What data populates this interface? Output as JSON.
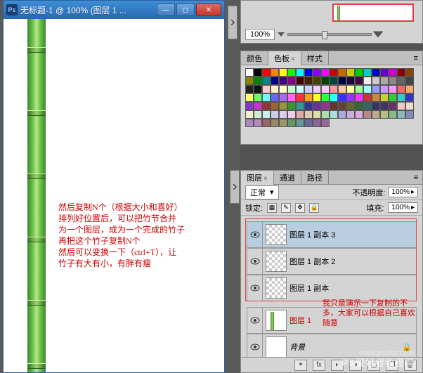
{
  "doc": {
    "title": "无标题-1 @ 100% (图层 1 ..."
  },
  "nav": {
    "zoom": "100%"
  },
  "color_panel": {
    "tabs": {
      "color": "颜色",
      "swatch": "色板",
      "styles": "样式"
    }
  },
  "layers_panel": {
    "tabs": {
      "layers": "图层",
      "channels": "通道",
      "paths": "路径"
    },
    "blend": "正常",
    "opacity_label": "不透明度:",
    "opacity_val": "100%",
    "lock_label": "锁定:",
    "fill_label": "填充:",
    "fill_val": "100%",
    "layers": [
      {
        "name": "图层 1 副本 3"
      },
      {
        "name": "图层 1 副本 2"
      },
      {
        "name": "图层 1 副本"
      },
      {
        "name": "图层 1"
      },
      {
        "name": "背景"
      }
    ]
  },
  "annotations": {
    "main": "然后复制N个（根据大小和喜好）\n排列好位置后，可以把竹节合并\n为一个图层，成为一个完成的竹子\n再把这个竹子复制N个\n然后可以变换一下（ctrl+T），让\n竹子有大有小，有胖有瘦",
    "panel_note": "我只是演示一下复制的不\n多，大家可以根据自己喜欢\n随意"
  },
  "watermark": {
    "text": "PS爱好者教程网",
    "url": "www.psahz.com"
  },
  "swatch_colors": [
    "#fff",
    "#000",
    "#f00",
    "#ff8000",
    "#ff0",
    "#0f0",
    "#0ff",
    "#00f",
    "#80f",
    "#f0f",
    "#c00",
    "#c60",
    "#cc0",
    "#0c0",
    "#0cc",
    "#00c",
    "#60c",
    "#c0c",
    "#800",
    "#840",
    "#880",
    "#080",
    "#088",
    "#008",
    "#408",
    "#808",
    "#400",
    "#420",
    "#440",
    "#040",
    "#044",
    "#004",
    "#204",
    "#404",
    "#eee",
    "#ccc",
    "#aaa",
    "#888",
    "#666",
    "#444",
    "#222",
    "#111",
    "#fcc",
    "#fec",
    "#ffc",
    "#cfc",
    "#cff",
    "#ccf",
    "#ecf",
    "#fcf",
    "#f99",
    "#fc9",
    "#ff9",
    "#9f9",
    "#9ff",
    "#99f",
    "#c9f",
    "#f9f",
    "#f66",
    "#fa6",
    "#ff6",
    "#6f6",
    "#6ff",
    "#66f",
    "#a6f",
    "#f6f",
    "#f33",
    "#f93",
    "#ff3",
    "#3f3",
    "#3ff",
    "#33f",
    "#93f",
    "#f3f",
    "#c33",
    "#c83",
    "#cc3",
    "#3c3",
    "#3cc",
    "#33c",
    "#83c",
    "#c3c",
    "#933",
    "#963",
    "#993",
    "#393",
    "#399",
    "#339",
    "#639",
    "#939",
    "#633",
    "#643",
    "#663",
    "#363",
    "#366",
    "#336",
    "#436",
    "#636",
    "#ecc",
    "#edc",
    "#eec",
    "#cec",
    "#cee",
    "#cce",
    "#dce",
    "#ece",
    "#daa",
    "#dca",
    "#dda",
    "#ada",
    "#add",
    "#aad",
    "#cad",
    "#dad",
    "#b88",
    "#ba8",
    "#bb8",
    "#8b8",
    "#8bb",
    "#88b",
    "#a8b",
    "#b8b",
    "#966",
    "#986",
    "#996",
    "#696",
    "#699",
    "#669",
    "#869",
    "#969"
  ]
}
